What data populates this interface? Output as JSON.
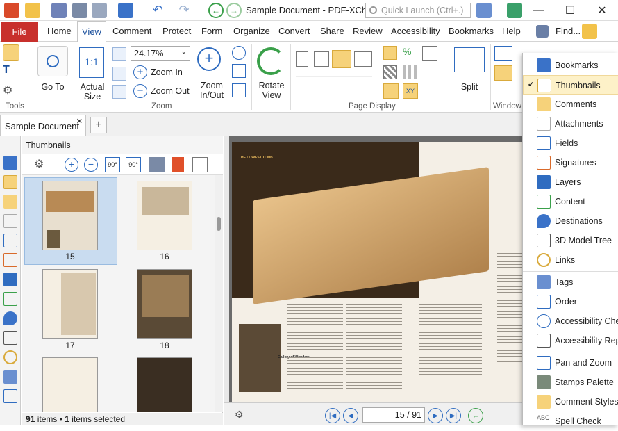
{
  "window": {
    "title": "Sample Document - PDF-XCha...",
    "quick_launch_placeholder": "Quick Launch (Ctrl+.)"
  },
  "menu": {
    "file": "File",
    "tabs": [
      "Home",
      "View",
      "Comment",
      "Protect",
      "Form",
      "Organize",
      "Convert",
      "Share",
      "Review",
      "Accessibility",
      "Bookmarks",
      "Help"
    ],
    "find": "Find..."
  },
  "ribbon": {
    "tools_label": "Tools",
    "goto_label": "Go To",
    "actual_size_label": "Actual Size",
    "zoom_value": "24.17%",
    "zoom_in_label": "Zoom In",
    "zoom_out_label": "Zoom Out",
    "zoom_inout_label": "Zoom In/Out",
    "rotate_view_label": "Rotate View",
    "zoom_group": "Zoom",
    "page_display_group": "Page Display",
    "split_label": "Split",
    "window_group": "Window"
  },
  "doc_tab": {
    "title": "Sample Document"
  },
  "thumbnails": {
    "panel_title": "Thumbnails",
    "pages": [
      "15",
      "16",
      "17",
      "18"
    ],
    "selected_page": "15"
  },
  "status": {
    "items_count": "91",
    "items_text": "items",
    "selected_count": "1",
    "selected_text": "items selected"
  },
  "nav": {
    "current_page": "15",
    "total_pages": "91"
  },
  "side_menu": {
    "items": [
      "Bookmarks",
      "Thumbnails",
      "Comments",
      "Attachments",
      "Fields",
      "Signatures",
      "Layers",
      "Content",
      "Destinations",
      "3D Model Tree",
      "Links",
      "Tags",
      "Order",
      "Accessibility Chec",
      "Accessibility Repo",
      "Pan and Zoom",
      "Stamps Palette",
      "Comment Styles",
      "Spell Check"
    ],
    "checked": "Thumbnails"
  },
  "page_content": {
    "heading": "THE LOWEST TOMB",
    "caption_gallery": "Gallery of Wonders"
  },
  "colors": {
    "accent": "#1a4f9c",
    "file_tab": "#c8302c",
    "selection": "#c9dcf0",
    "checked_item": "#fdf1c8"
  }
}
